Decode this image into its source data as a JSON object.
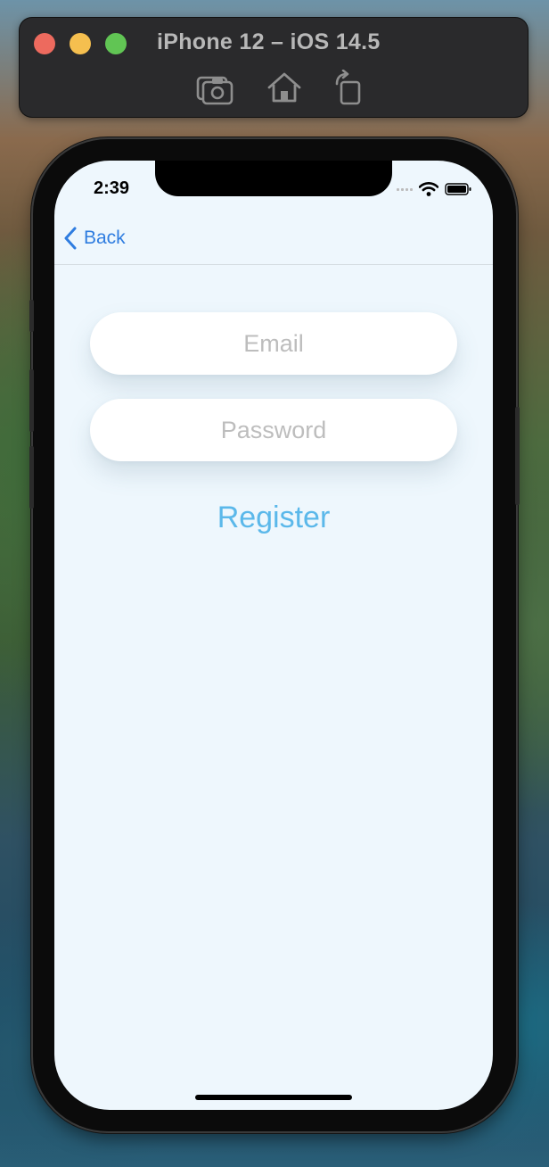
{
  "simulator": {
    "title": "iPhone 12 – iOS 14.5",
    "toolbar": {
      "screenshot_icon": "camera-icon",
      "home_icon": "home-icon",
      "rotate_icon": "rotate-icon"
    }
  },
  "status_bar": {
    "time": "2:39"
  },
  "nav": {
    "back_label": "Back"
  },
  "form": {
    "email_placeholder": "Email",
    "email_value": "",
    "password_placeholder": "Password",
    "password_value": ""
  },
  "actions": {
    "register_label": "Register"
  },
  "colors": {
    "accent_blue": "#2f7de0",
    "register_blue": "#5bb8ea",
    "screen_background": "#eef7fd",
    "placeholder_gray": "#bdbdbd"
  }
}
